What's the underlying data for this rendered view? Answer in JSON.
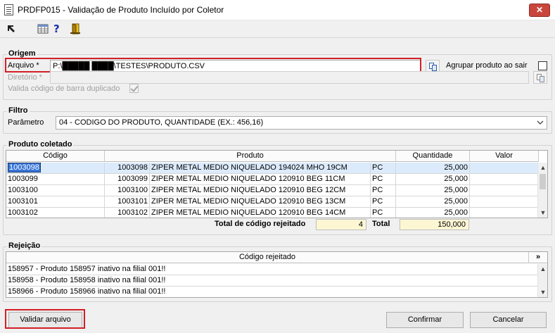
{
  "window": {
    "title": "PRDFP015 - Validação de Produto Incluído por Coletor",
    "close_glyph": "✕"
  },
  "toolbar": {
    "icons": [
      "arrow-icon",
      "grid-icon",
      "help-icon",
      "exit-door-icon"
    ],
    "help_glyph": "?"
  },
  "origem": {
    "title": "Origem",
    "arquivo_label": "Arquivo *",
    "arquivo_value": "P:\\█████  ████\\TESTES\\PRODUTO.CSV",
    "agrupar_label": "Agrupar produto ao sair",
    "diretorio_label": "Diretório *",
    "valida_label": "Valida código de barra duplicado"
  },
  "filtro": {
    "title": "Filtro",
    "parametro_label": "Parâmetro",
    "parametro_value": "04 - CODIGO DO PRODUTO, QUANTIDADE (EX.: 456,16)"
  },
  "produto": {
    "title": "Produto coletado",
    "columns": [
      "Código",
      "Produto",
      "Quantidade",
      "Valor"
    ],
    "rows": [
      {
        "codigo": "1003098",
        "num": "1003098",
        "desc": "ZIPER METAL MEDIO NIQUELADO 194024 MHO 19CM",
        "un": "PC",
        "qtd": "25,000",
        "valor": ""
      },
      {
        "codigo": "1003099",
        "num": "1003099",
        "desc": "ZIPER METAL MEDIO NIQUELADO 120910 BEG 11CM",
        "un": "PC",
        "qtd": "25,000",
        "valor": ""
      },
      {
        "codigo": "1003100",
        "num": "1003100",
        "desc": "ZIPER METAL MEDIO NIQUELADO 120910 BEG 12CM",
        "un": "PC",
        "qtd": "25,000",
        "valor": ""
      },
      {
        "codigo": "1003101",
        "num": "1003101",
        "desc": "ZIPER METAL MEDIO NIQUELADO 120910 BEG 13CM",
        "un": "PC",
        "qtd": "25,000",
        "valor": ""
      },
      {
        "codigo": "1003102",
        "num": "1003102",
        "desc": "ZIPER METAL MEDIO NIQUELADO 120910 BEG 14CM",
        "un": "PC",
        "qtd": "25,000",
        "valor": ""
      }
    ],
    "total_rejeitado_label": "Total de código rejeitado",
    "total_rejeitado_value": "4",
    "total_label": "Total",
    "total_value": "150,000"
  },
  "rejeicao": {
    "title": "Rejeição",
    "column": "Código rejeitado",
    "expand_glyph": "»",
    "rows": [
      "158957 - Produto 158957 inativo na filial 001!!",
      "158958 - Produto 158958 inativo na filial 001!!",
      "158966 - Produto 158966 inativo na filial 001!!"
    ]
  },
  "buttons": {
    "validar": "Validar arquivo",
    "confirmar": "Confirmar",
    "cancelar": "Cancelar"
  },
  "colors": {
    "highlight": "#d21f26",
    "selection": "#3875d7",
    "total_bg": "#fdf6d3",
    "close": "#c9463d"
  }
}
